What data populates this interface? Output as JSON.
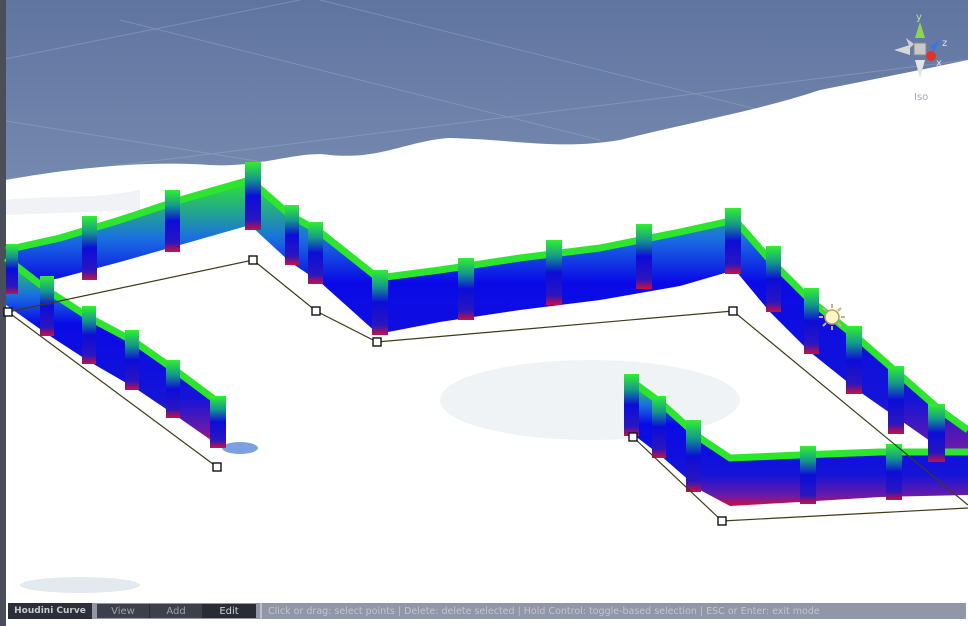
{
  "viewport": {
    "projection_label": "Iso",
    "gizmo_axes": {
      "y": "y",
      "z": "z",
      "x": "x"
    }
  },
  "statusbar": {
    "title": "Houdini Curve",
    "modes": [
      "View",
      "Add",
      "Edit"
    ],
    "active_mode": "Edit",
    "hint": "Click or drag: select points | Delete: delete selected | Hold Control: toggle-based selection | ESC or Enter: exit mode"
  },
  "colors": {
    "fence_top": "#2ee52e",
    "fence_body": "#0a0ae6",
    "fence_bottom": "#c0103a",
    "curve_line": "#4a4420",
    "sky": "#7c8fb3",
    "snow": "#ffffff"
  }
}
